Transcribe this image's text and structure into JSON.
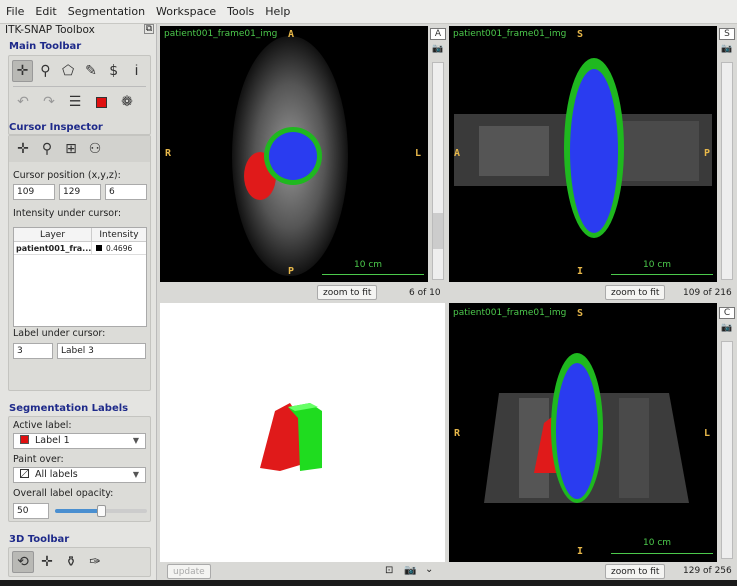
{
  "menu": [
    "File",
    "Edit",
    "Segmentation",
    "Workspace",
    "Tools",
    "Help"
  ],
  "toolbox": {
    "title": "ITK-SNAP Toolbox",
    "main_toolbar": {
      "title": "Main Toolbar",
      "tools": [
        "crosshair-icon",
        "zoom-icon",
        "polygon-icon",
        "paintbrush-icon",
        "snake-icon",
        "ruler-annotation-icon"
      ],
      "tools2": [
        "undo-icon",
        "redo-icon",
        "layers-icon",
        "label-color-icon",
        "palette-icon"
      ]
    },
    "cursor_inspector": {
      "title": "Cursor Inspector",
      "position_label": "Cursor position (x,y,z):",
      "x": "109",
      "y": "129",
      "z": "6",
      "intensity_label": "Intensity under cursor:",
      "columns": [
        "Layer",
        "Intensity"
      ],
      "rows": [
        {
          "layer": "patient001_fra...",
          "intensity": "0.4696"
        }
      ],
      "label_under_label": "Label under cursor:",
      "label_id": "3",
      "label_name": "Label 3"
    },
    "seg_labels": {
      "title": "Segmentation Labels",
      "active_label_caption": "Active label:",
      "active_label": "Label 1",
      "active_color": "#e01010",
      "paint_over_caption": "Paint over:",
      "paint_over": "All labels",
      "opacity_caption": "Overall label opacity:",
      "opacity": "50",
      "opacity_fraction": 0.5
    },
    "toolbar3d": {
      "title": "3D Toolbar"
    }
  },
  "views": {
    "axial": {
      "title": "patient001_frame01_img",
      "top": "A",
      "left": "R",
      "right": "L",
      "bottom": "P",
      "scale": "10 cm",
      "zoom": "zoom to fit",
      "slice": "6 of 10",
      "side": "A"
    },
    "sagittal": {
      "title": "patient001_frame01_img",
      "top": "S",
      "left": "A",
      "right": "P",
      "bottom": "I",
      "scale": "10 cm",
      "zoom": "zoom to fit",
      "slice": "109 of 216",
      "side": "S"
    },
    "coronal": {
      "title": "patient001_frame01_img",
      "top": "S",
      "left": "R",
      "right": "L",
      "bottom": "I",
      "scale": "10 cm",
      "zoom": "zoom to fit",
      "slice": "129 of 256",
      "side": "C"
    },
    "render3d": {
      "update": "update"
    }
  },
  "colors": {
    "lv_blood": "#2a3cf0",
    "myocardium": "#1fb81f",
    "rv": "#e01a1a",
    "overlay_text": "#4cc94c",
    "orientation": "#e8b84a",
    "header": "#1e2a8a"
  }
}
